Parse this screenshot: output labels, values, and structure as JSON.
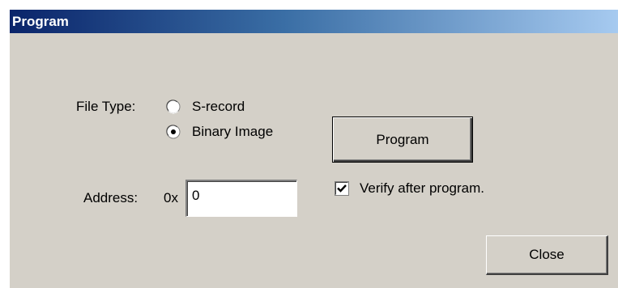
{
  "window": {
    "title": "Program"
  },
  "file_type": {
    "label": "File Type:",
    "options": [
      {
        "label": "S-record",
        "selected": false
      },
      {
        "label": "Binary Image",
        "selected": true
      }
    ]
  },
  "address": {
    "label": "Address:",
    "prefix": "0x",
    "value": "0"
  },
  "program_button": {
    "label": "Program"
  },
  "verify": {
    "label": "Verify after program.",
    "checked": true
  },
  "close_button": {
    "label": "Close"
  },
  "colors": {
    "dialog_face": "#d4d0c8",
    "titlebar_start": "#0a246a",
    "titlebar_end": "#a6caf0",
    "title_text": "#ffffff"
  },
  "icons": {
    "radio_unselected": "radio-unselected-icon",
    "radio_selected": "radio-selected-icon",
    "checkbox_checked": "checkbox-checked-icon"
  }
}
